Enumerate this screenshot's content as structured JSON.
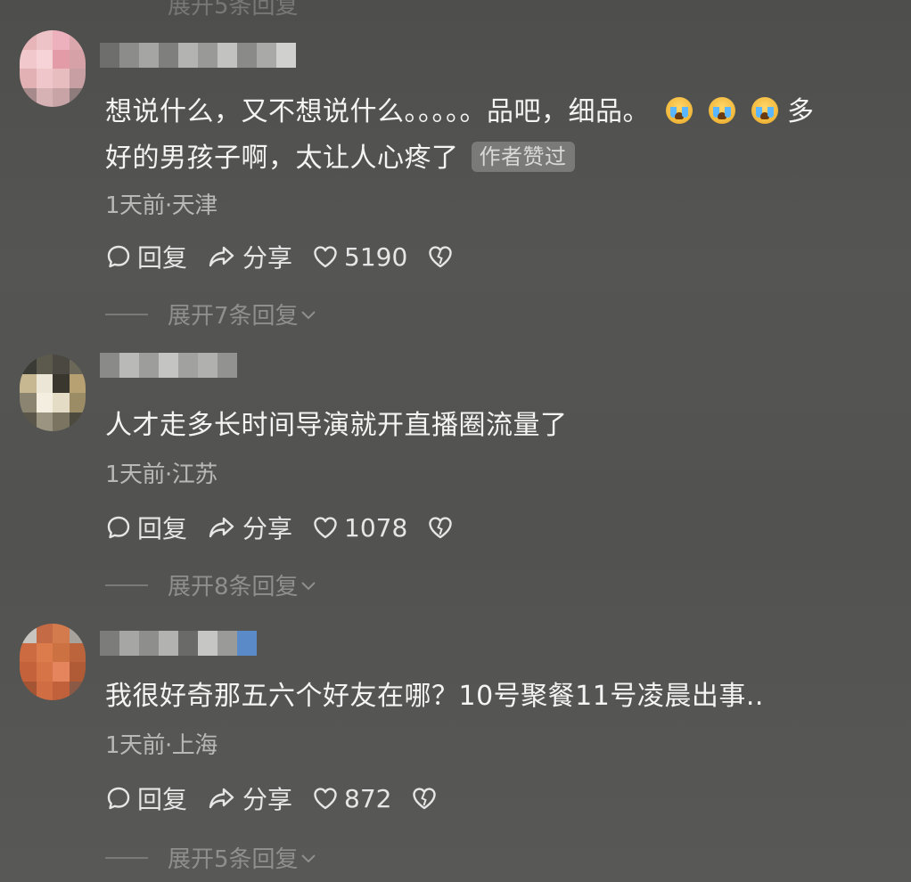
{
  "top_fade_text": "展开5条回复",
  "colors": {
    "background": "#535351",
    "text_primary": "#f4f4f4",
    "text_meta": "#b8b8b6",
    "text_muted": "#8f8f8d",
    "badge_bg": "#7a7a78"
  },
  "comments": [
    {
      "text_line1": "想说什么，又不想说什么。。。。。品吧，细品。",
      "text_overflow": "多",
      "text_line2": "好的男孩子啊，太让人心疼了",
      "emojis": [
        "crying-face-icon",
        "crying-face-icon",
        "crying-face-icon"
      ],
      "badge": "作者赞过",
      "meta": "1天前·天津",
      "reply_label": "回复",
      "share_label": "分享",
      "likes": "5190",
      "expand_label": "展开7条回复"
    },
    {
      "text_line1": "人才走多长时间导演就开直播圈流量了",
      "meta": "1天前·江苏",
      "reply_label": "回复",
      "share_label": "分享",
      "likes": "1078",
      "expand_label": "展开8条回复"
    },
    {
      "text_line1": "我很好奇那五六个好友在哪？10号聚餐11号凌晨出事..",
      "meta": "1天前·上海",
      "reply_label": "回复",
      "share_label": "分享",
      "likes": "872",
      "expand_label": "展开5条回复"
    }
  ]
}
